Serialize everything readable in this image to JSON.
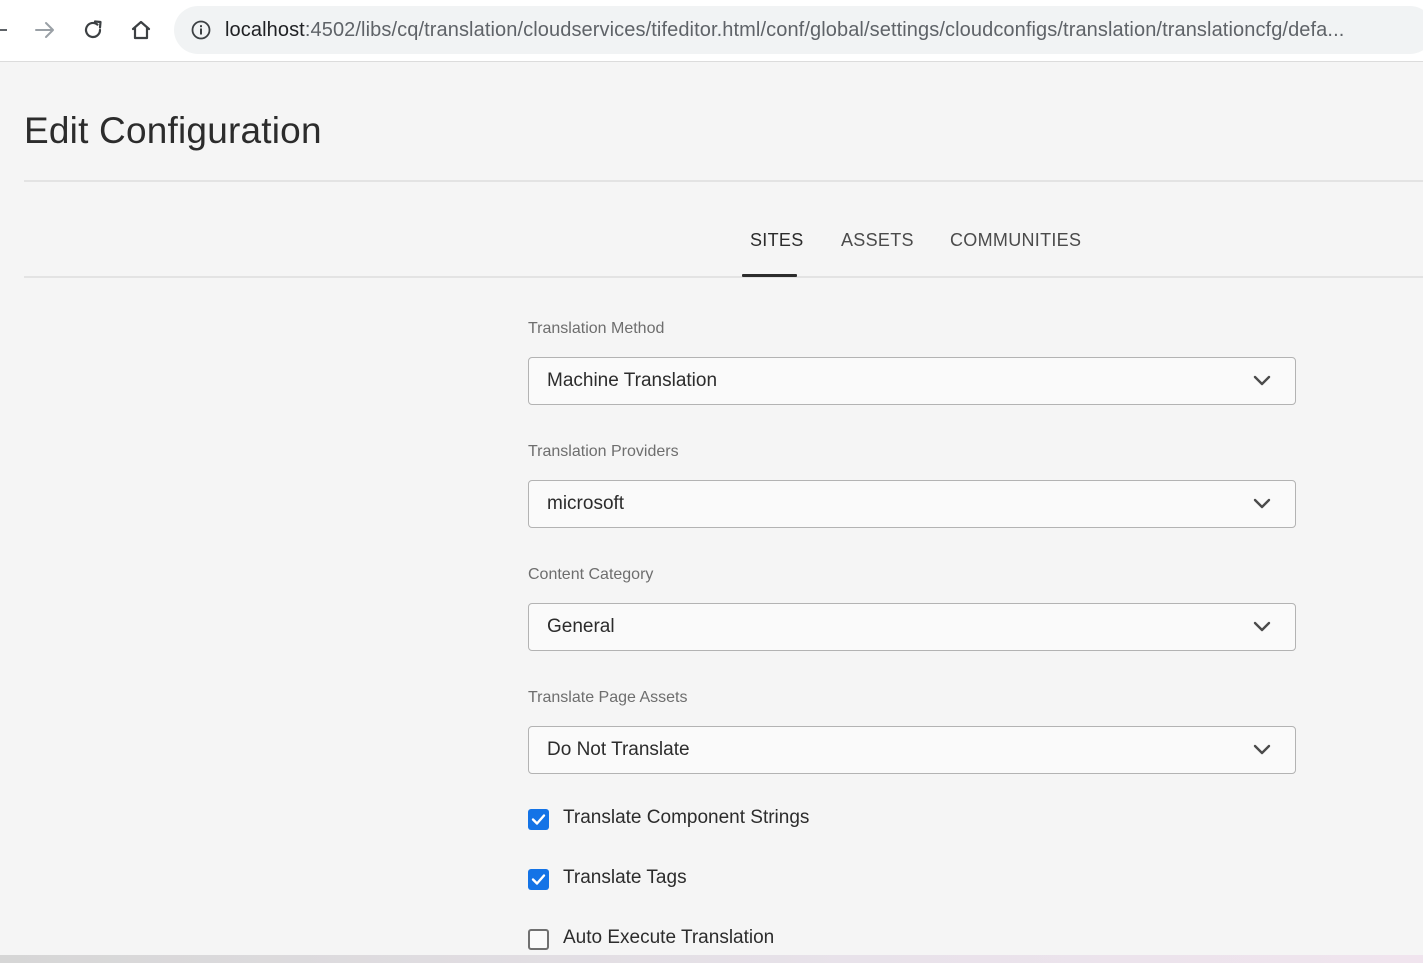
{
  "browser": {
    "url_host": "localhost",
    "url_rest": ":4502/libs/cq/translation/cloudservices/tifeditor.html/conf/global/settings/cloudconfigs/translation/translationcfg/defa..."
  },
  "page": {
    "title": "Edit Configuration"
  },
  "tabs": [
    {
      "label": "SITES",
      "active": true
    },
    {
      "label": "ASSETS",
      "active": false
    },
    {
      "label": "COMMUNITIES",
      "active": false
    }
  ],
  "form": {
    "translation_method": {
      "label": "Translation Method",
      "value": "Machine Translation"
    },
    "translation_providers": {
      "label": "Translation Providers",
      "value": "microsoft"
    },
    "content_category": {
      "label": "Content Category",
      "value": "General"
    },
    "translate_page_assets": {
      "label": "Translate Page Assets",
      "value": "Do Not Translate"
    },
    "checkboxes": [
      {
        "label": "Translate Component Strings",
        "checked": true
      },
      {
        "label": "Translate Tags",
        "checked": true
      },
      {
        "label": "Auto Execute Translation",
        "checked": false
      }
    ]
  },
  "colors": {
    "accent": "#1473e6",
    "background": "#f5f5f5"
  }
}
